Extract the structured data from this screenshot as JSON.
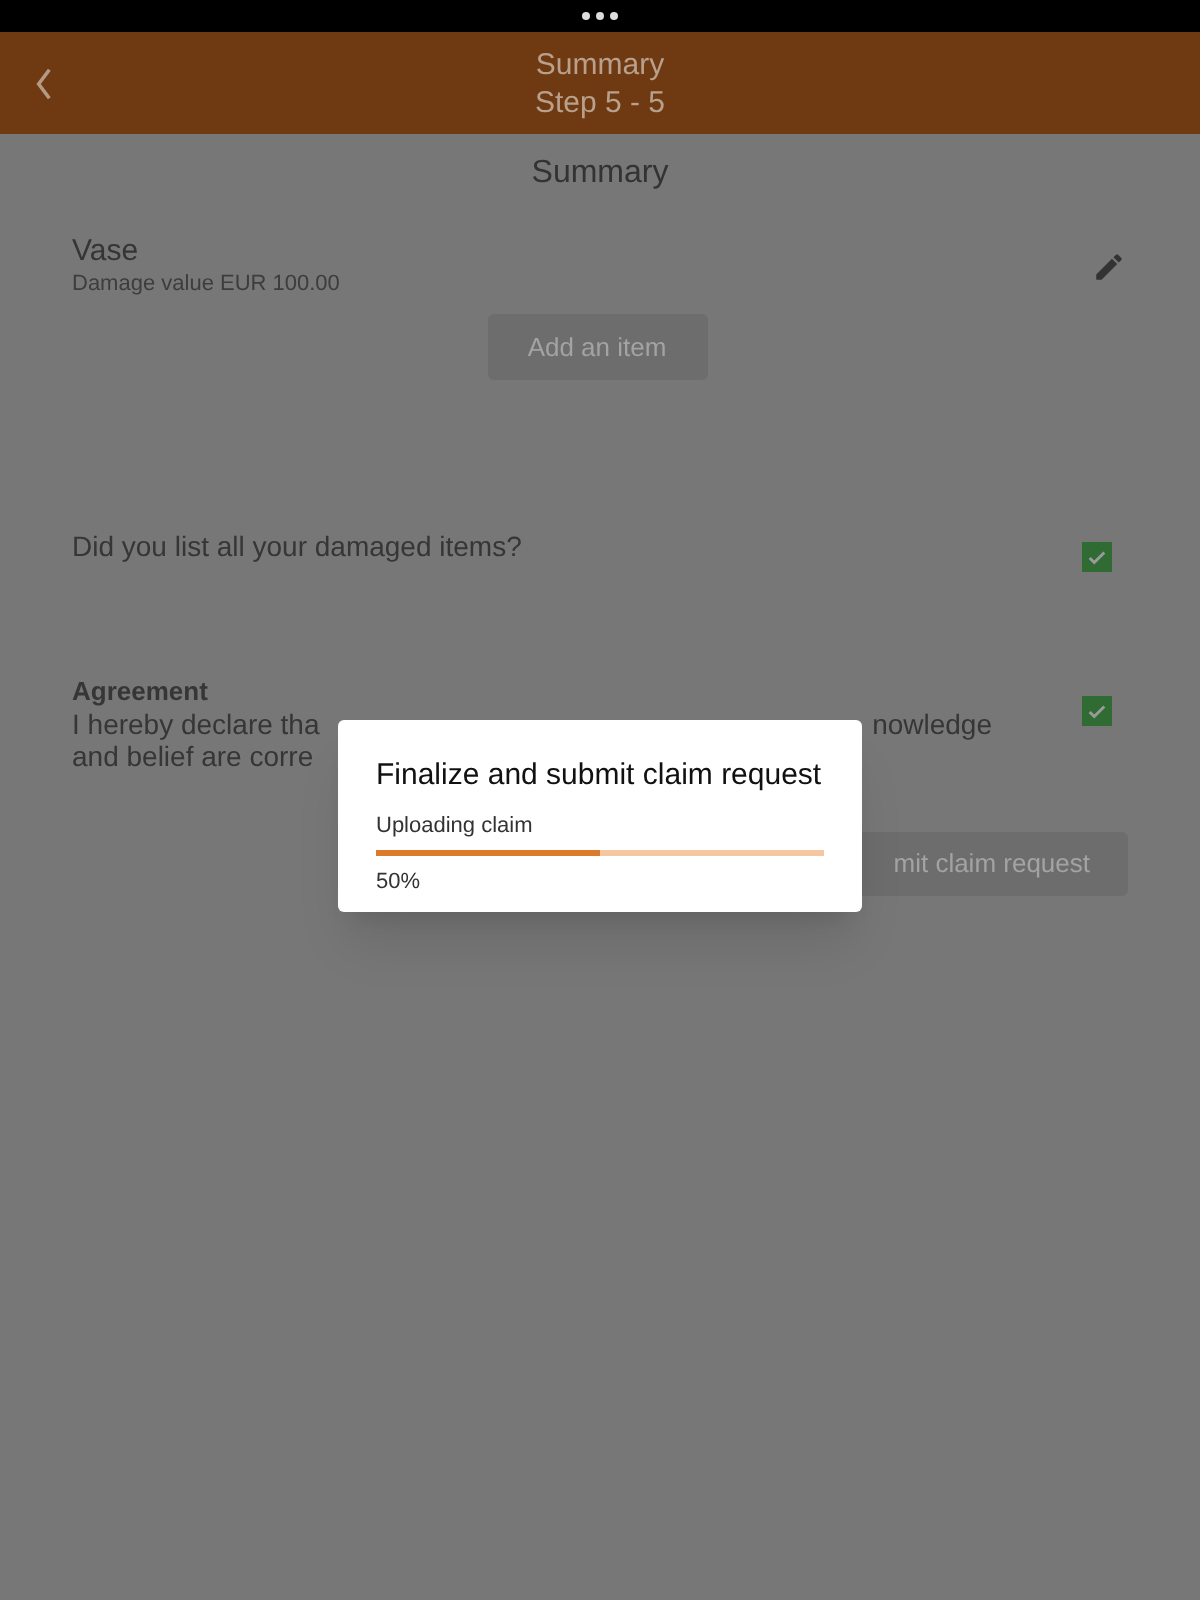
{
  "header": {
    "title": "Summary",
    "subtitle": "Step 5 - 5"
  },
  "section_title": "Summary",
  "items": [
    {
      "name": "Vase",
      "detail": "Damage value EUR 100.00"
    }
  ],
  "add_button": "Add an item",
  "confirmation": {
    "question": "Did you list all your damaged items?",
    "checked": true
  },
  "agreement": {
    "heading": "Agreement",
    "line_1_start": "I hereby declare tha",
    "line_1_end": "nowledge",
    "line_2_start": "and belief are corre",
    "checked": true
  },
  "submit_button": "mit claim request",
  "dialog": {
    "title": "Finalize and submit claim request",
    "status": "Uploading claim",
    "level": 0.5,
    "percent": "50%"
  }
}
